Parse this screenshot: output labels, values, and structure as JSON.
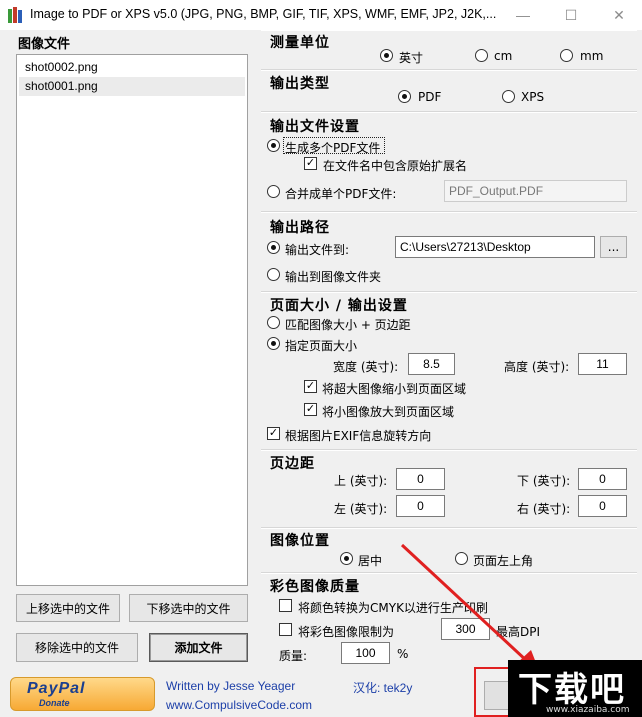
{
  "window": {
    "title": "Image to PDF or XPS  v5.0   (JPG, PNG, BMP, GIF, TIF, XPS, WMF, EMF, JP2, J2K,...",
    "minimize": "—",
    "maximize": "☐",
    "close": "✕"
  },
  "files": {
    "title": "图像文件",
    "items": [
      "shot0002.png",
      "shot0001.png"
    ],
    "move_up": "上移选中的文件",
    "move_down": "下移选中的文件",
    "remove": "移除选中的文件",
    "add": "添加文件"
  },
  "units": {
    "title": "测量单位",
    "options": [
      "英寸",
      "cm",
      "mm"
    ],
    "selected": "英寸"
  },
  "output_type": {
    "title": "输出类型",
    "options": [
      "PDF",
      "XPS"
    ],
    "selected": "PDF"
  },
  "output_file": {
    "title": "输出文件设置",
    "multi": "生成多个PDF文件",
    "include_ext": "在文件名中包含原始扩展名",
    "single": "合并成单个PDF文件:",
    "single_name": "PDF_Output.PDF"
  },
  "output_path": {
    "title": "输出路径",
    "to_label": "输出文件到:",
    "path": "C:\\Users\\27213\\Desktop",
    "browse": "...",
    "to_image_folder": "输出到图像文件夹"
  },
  "page_size": {
    "title": "页面大小 / 输出设置",
    "match": "匹配图像大小 + 页边距",
    "specify": "指定页面大小",
    "width_label": "宽度 (英寸):",
    "width": "8.5",
    "height_label": "高度 (英寸):",
    "height": "11",
    "shrink": "将超大图像缩小到页面区域",
    "enlarge": "将小图像放大到页面区域",
    "exif": "根据图片EXIF信息旋转方向"
  },
  "margins": {
    "title": "页边距",
    "top_label": "上 (英寸):",
    "top": "0",
    "bottom_label": "下 (英寸):",
    "bottom": "0",
    "left_label": "左 (英寸):",
    "left": "0",
    "right_label": "右 (英寸):",
    "right": "0"
  },
  "image_position": {
    "title": "图像位置",
    "center": "居中",
    "top_left": "页面左上角"
  },
  "color_quality": {
    "title": "彩色图像质量",
    "cmyk": "将颜色转换为CMYK以进行生产印刷",
    "limit": "将彩色图像限制为",
    "dpi": "300",
    "dpi_suffix": "最高DPI",
    "quality_label": "质量:",
    "quality": "100",
    "quality_unit": "%"
  },
  "footer": {
    "paypal": "PayPal",
    "donate": "Donate",
    "author": "Written by Jesse Yeager",
    "site": "www.CompulsiveCode.com",
    "localize": "汉化: tek2y"
  },
  "watermark": {
    "logo": "下载吧",
    "url": "www.xiazaiba.com"
  },
  "colors": {
    "annotation_red": "#e02020",
    "link_blue": "#1c3fa8"
  }
}
